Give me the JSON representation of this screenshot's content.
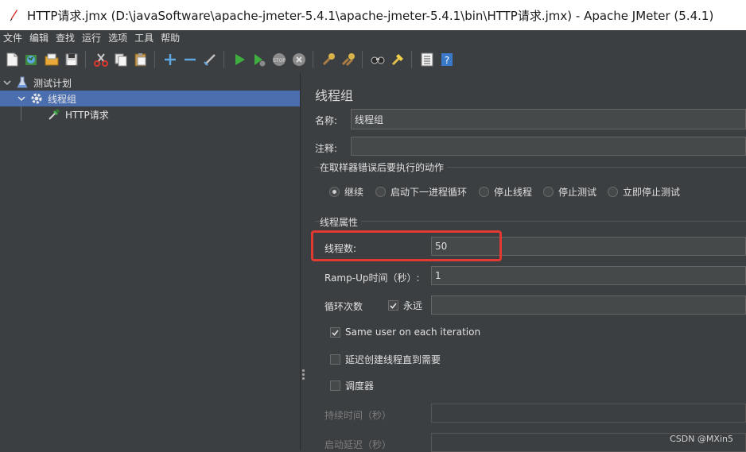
{
  "window": {
    "title": "HTTP请求.jmx (D:\\javaSoftware\\apache-jmeter-5.4.1\\apache-jmeter-5.4.1\\bin\\HTTP请求.jmx) - Apache JMeter (5.4.1)",
    "app_icon": "feather-icon"
  },
  "menu": [
    "文件",
    "编辑",
    "查找",
    "运行",
    "选项",
    "工具",
    "帮助"
  ],
  "toolbar": {
    "icons": [
      "new-icon",
      "templates-icon",
      "open-icon",
      "save-icon",
      "cut-icon",
      "copy-icon",
      "paste-icon",
      "expand-icon",
      "collapse-icon",
      "toggle-icon",
      "start-icon",
      "start-no-pause-icon",
      "stop-icon",
      "shutdown-icon",
      "clear-icon",
      "clear-all-icon",
      "search-icon",
      "reset-search-icon",
      "function-helper-icon",
      "help-icon"
    ]
  },
  "tree": {
    "items": [
      {
        "label": "测试计划",
        "icon": "test-plan-icon",
        "expanded": true
      },
      {
        "label": "线程组",
        "icon": "gear-icon",
        "expanded": true,
        "selected": true
      },
      {
        "label": "HTTP请求",
        "icon": "pipette-icon"
      }
    ]
  },
  "panel": {
    "title": "线程组",
    "name_label": "名称:",
    "name_value": "线程组",
    "comment_label": "注释:",
    "comment_value": "",
    "error_group_title": "在取样器错误后要执行的动作",
    "error_actions": [
      {
        "label": "继续",
        "selected": true
      },
      {
        "label": "启动下一进程循环",
        "selected": false
      },
      {
        "label": "停止线程",
        "selected": false
      },
      {
        "label": "停止测试",
        "selected": false
      },
      {
        "label": "立即停止测试",
        "selected": false
      }
    ],
    "thread_group_title": "线程属性",
    "threads_label": "线程数:",
    "threads_value": "50",
    "rampup_label": "Ramp-Up时间（秒）:",
    "rampup_value": "1",
    "loop_label": "循环次数",
    "loop_forever_label": "永远",
    "loop_forever_checked": true,
    "loop_value": "",
    "same_user_label": "Same user on each iteration",
    "same_user_checked": true,
    "delay_label": "延迟创建线程直到需要",
    "delay_checked": false,
    "scheduler_label": "调度器",
    "scheduler_checked": false,
    "duration_label": "持续时间（秒）",
    "duration_value": "",
    "startup_delay_label": "启动延迟（秒）",
    "startup_delay_value": ""
  },
  "colors": {
    "background": "#3c3f41",
    "selection": "#4b6eaf",
    "highlight_box": "#e23a32"
  },
  "watermark": "CSDN @MXin5"
}
